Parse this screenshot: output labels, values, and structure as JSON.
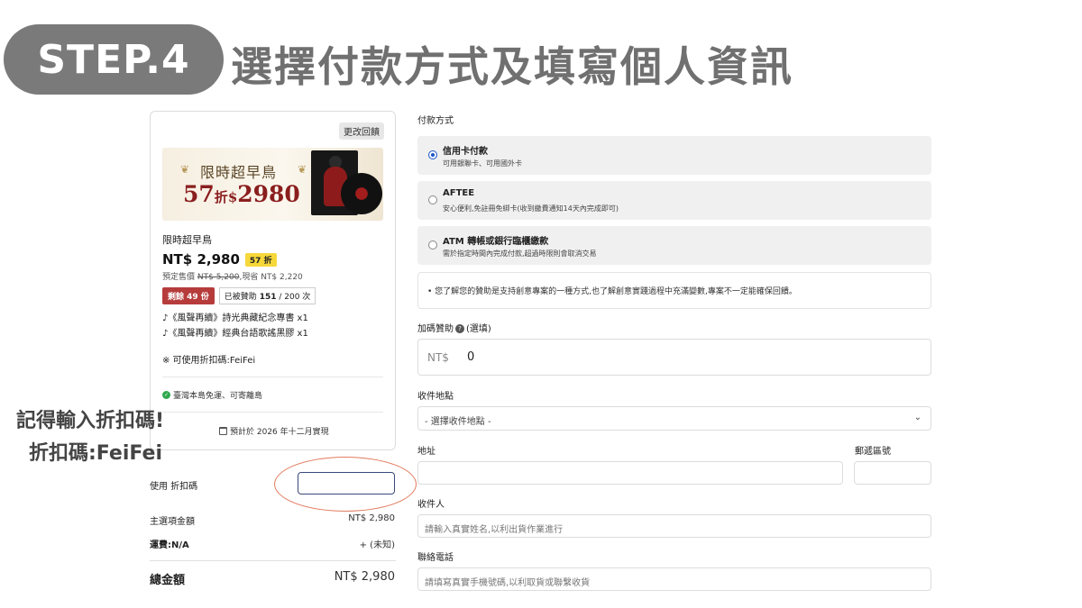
{
  "header": {
    "step_label": "STEP.4",
    "title": "選擇付款方式及填寫個人資訊"
  },
  "notes": {
    "line1": "記得輸入折扣碼!",
    "line2": "折扣碼:FeiFei"
  },
  "card": {
    "change_button": "更改回饋",
    "banner": {
      "line1": "限時超早鳥",
      "discount_num": "57",
      "discount_char": "折",
      "currency": "$",
      "amount": "2980"
    },
    "title": "限時超早鳥",
    "price": "NT$ 2,980",
    "discount_badge": "57 折",
    "orig_prefix": "預定售價",
    "orig_price": "NT$ 5,200",
    "orig_suffix": ",現省 NT$ 2,220",
    "remaining": "剩餘 49 份",
    "backers_prefix": "已被贊助",
    "backers_count": "151",
    "backers_total": "/ 200 次",
    "rewards": [
      "♪《風聲再續》詩光典藏紀念專書 x1",
      "♪《風聲再續》經典台語歌謠黑膠 x1"
    ],
    "coupon_note": "※ 可使用折扣碼:FeiFei",
    "shipping": "臺灣本島免運、可寄離島",
    "delivery": "預計於 2026 年十二月實現"
  },
  "summary": {
    "coupon_label": "使用 折扣碼",
    "coupon_value": "",
    "subtotal_label": "主選項金額",
    "subtotal_value": "NT$ 2,980",
    "shipping_label": "運費:N/A",
    "shipping_value": "+ (未知)",
    "total_label": "總金額",
    "total_value": "NT$ 2,980"
  },
  "payment": {
    "section_label": "付款方式",
    "options": [
      {
        "title": "信用卡付款",
        "desc": "可用銀聯卡、可用國外卡",
        "selected": true
      },
      {
        "title": "AFTEE",
        "desc": "安心便利,免註冊免綁卡(收到繳費通知14天內完成即可)",
        "selected": false
      },
      {
        "title": "ATM 轉帳或銀行臨櫃繳款",
        "desc": "需於指定時間內完成付款,超過時限則會取消交易",
        "selected": false
      }
    ],
    "notice": "•  您了解您的贊助是支持創意專案的一種方式,也了解創意實踐過程中充滿變數,專案不一定能確保回饋。"
  },
  "form": {
    "extra_label": "加碼贊助",
    "extra_optional": "(選填)",
    "extra_prefix": "NT$",
    "extra_value": "0",
    "location_label": "收件地點",
    "location_placeholder": "- 選擇收件地點 -",
    "address_label": "地址",
    "zip_label": "郵遞區號",
    "recipient_label": "收件人",
    "recipient_placeholder": "請輸入真實姓名,以利出貨作業進行",
    "phone_label": "聯絡電話",
    "phone_placeholder": "請填寫真實手機號碼,以利取貨或聯繫收貨"
  }
}
